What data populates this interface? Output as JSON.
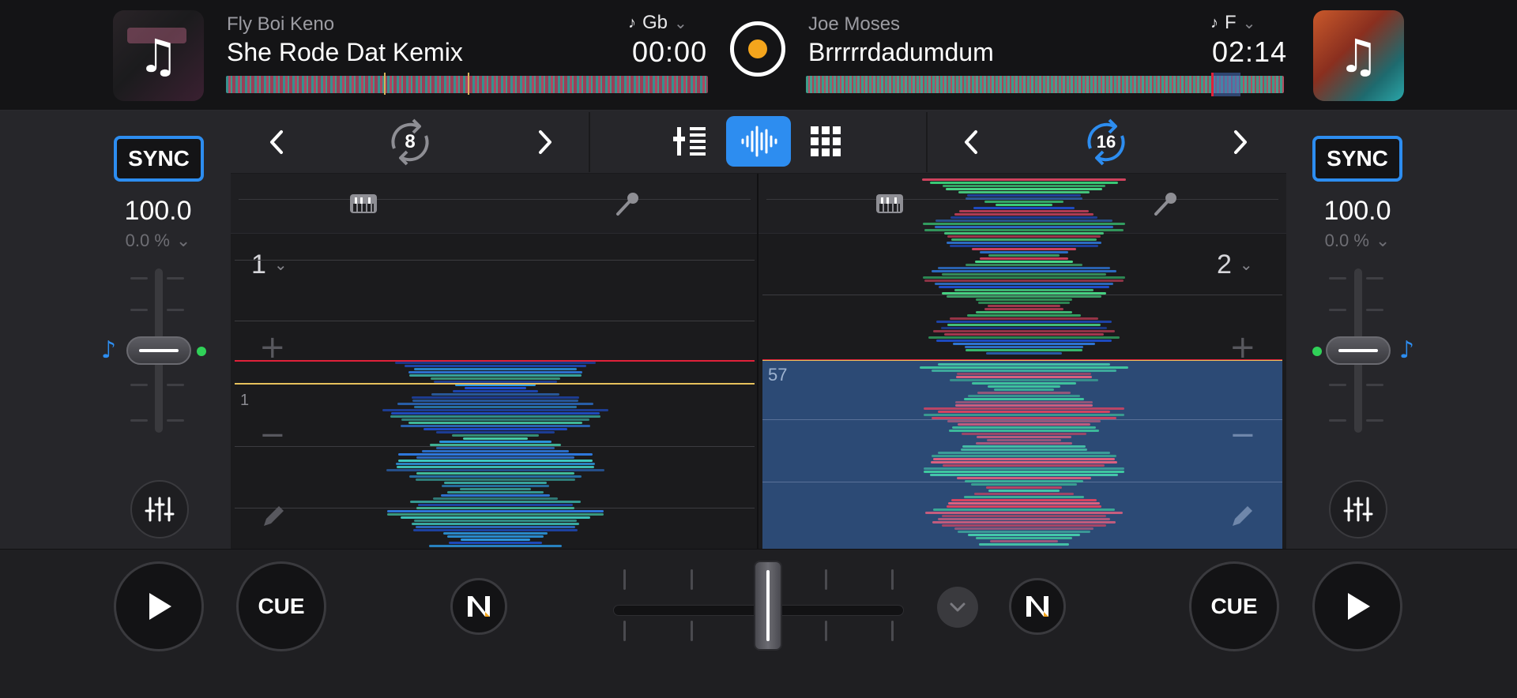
{
  "deck_a": {
    "artist": "Fly Boi Keno",
    "title": "She Rode Dat Kemix",
    "key": "Gb",
    "time": "00:00",
    "sync_label": "SYNC",
    "bpm": "100.0",
    "pitch": "0.0 %",
    "loop_size": "8",
    "deck_number": "1",
    "beat_marker": "1",
    "cue_label": "CUE"
  },
  "deck_b": {
    "artist": "Joe Moses",
    "title": "Brrrrrdadumdum",
    "key": "F",
    "time": "02:14",
    "sync_label": "SYNC",
    "bpm": "100.0",
    "pitch": "0.0 %",
    "loop_size": "16",
    "deck_number": "2",
    "loop_beats": "57",
    "cue_label": "CUE"
  },
  "colors": {
    "accent": "#2d8df0",
    "record": "#f4a51c",
    "playhead": "#e0213a",
    "cue_line": "#e6c15c",
    "sync_dot": "#30d158"
  },
  "icons": {
    "record": "record-icon",
    "prev": "chevron-left-icon",
    "next": "chevron-right-icon",
    "loop": "loop-icon",
    "mixer_view": "mixer-view-icon",
    "waveform_view": "waveform-view-icon",
    "pads_view": "pads-grid-icon",
    "keyboard": "keyboard-icon",
    "mic": "microphone-icon",
    "eq": "equalizer-icon",
    "play": "play-icon",
    "neural_mix": "neural-mix-icon",
    "note": "music-note-icon"
  }
}
